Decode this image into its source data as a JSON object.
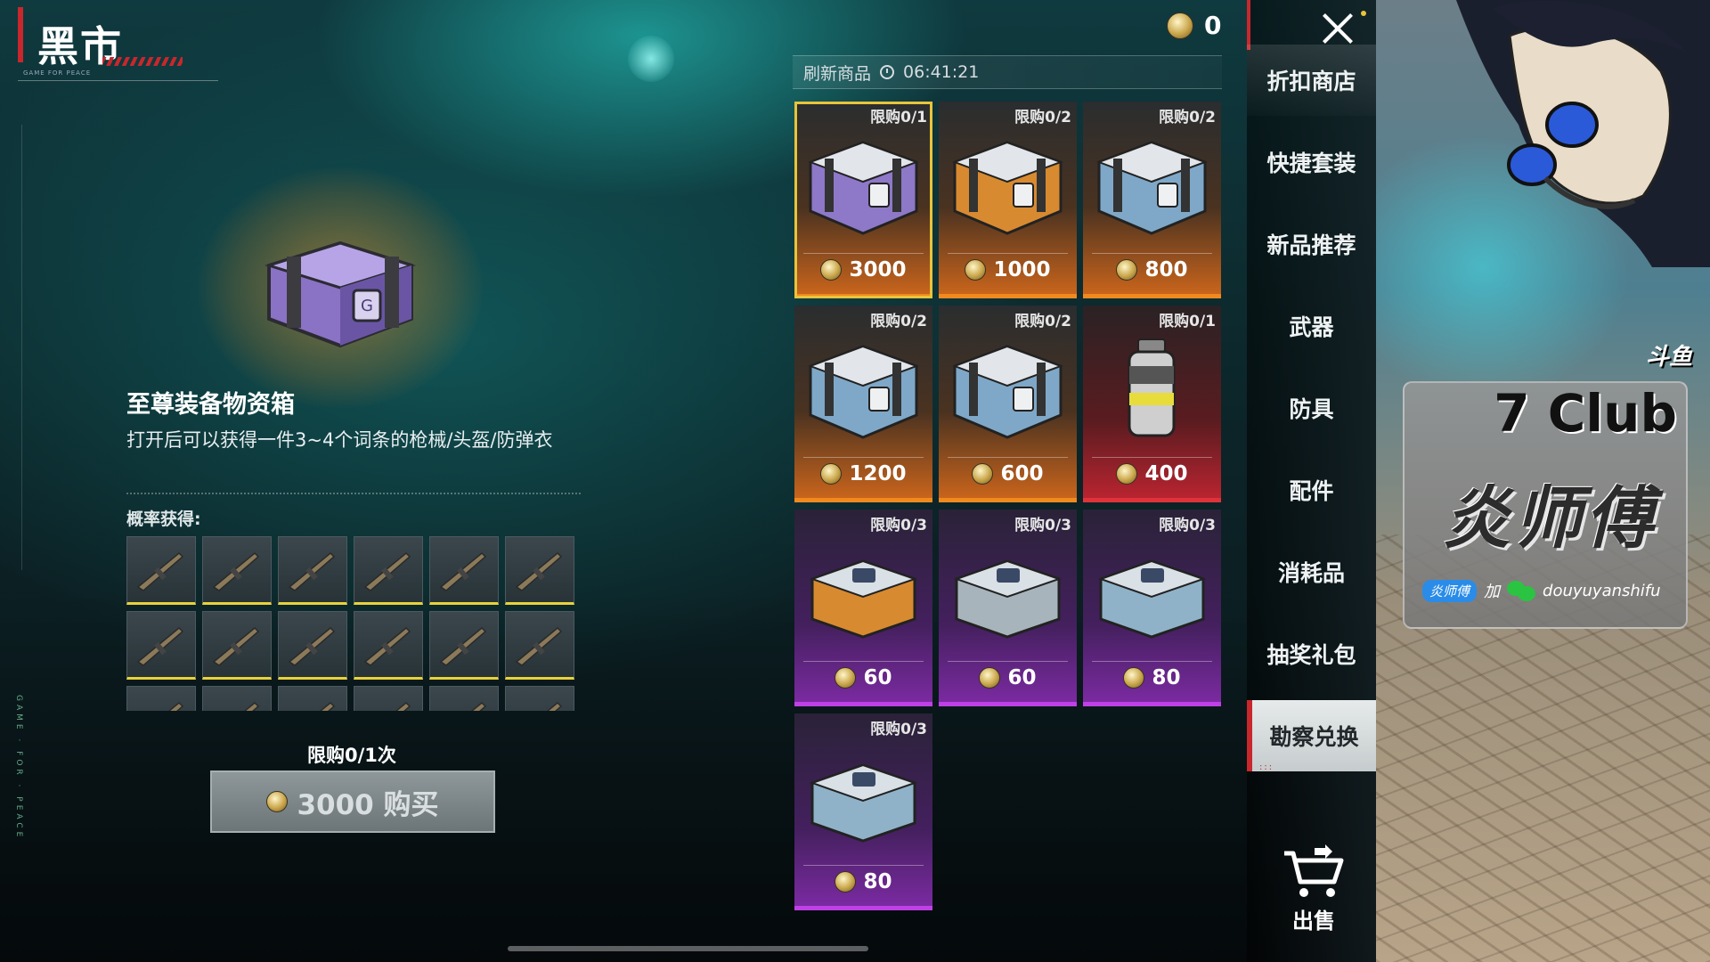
{
  "header": {
    "title": "黑市",
    "subtitle": "GAME FOR PEACE",
    "side_text": "GAME · FOR · PEACE"
  },
  "currency": {
    "amount": "0",
    "icon": "coin-icon"
  },
  "refresh": {
    "label": "刷新商品",
    "timer": "06:41:21"
  },
  "detail": {
    "name": "至尊装备物资箱",
    "description": "打开后可以获得一件3~4个词条的枪械/头盔/防弹衣",
    "prob_label": "概率获得:",
    "limit": "限购0/1次",
    "buy_label": "3000 购买",
    "gun_count": 18
  },
  "items": [
    {
      "limit": "限购0/1",
      "price": "3000",
      "theme": "orange",
      "icon": "purple-crate-icon",
      "color": "#8e78c8",
      "selected": true
    },
    {
      "limit": "限购0/2",
      "price": "1000",
      "theme": "orange",
      "icon": "orange-crate-icon",
      "color": "#d88a30"
    },
    {
      "limit": "限购0/2",
      "price": "800",
      "theme": "orange",
      "icon": "blue-crate-icon",
      "color": "#7fa8c8"
    },
    {
      "limit": "限购0/2",
      "price": "1200",
      "theme": "orange",
      "icon": "blue-crate-icon",
      "color": "#7fa8c8"
    },
    {
      "limit": "限购0/2",
      "price": "600",
      "theme": "orange",
      "icon": "blue-crate-icon",
      "color": "#7fa8c8"
    },
    {
      "limit": "限购0/1",
      "price": "400",
      "theme": "red",
      "icon": "canister-icon",
      "color": "#cfcfcf"
    },
    {
      "limit": "限购0/3",
      "price": "60",
      "theme": "purple",
      "icon": "orange-box-icon",
      "color": "#d88a30"
    },
    {
      "limit": "限购0/3",
      "price": "60",
      "theme": "purple",
      "icon": "gray-box-icon",
      "color": "#a8b4bc"
    },
    {
      "limit": "限购0/3",
      "price": "80",
      "theme": "purple",
      "icon": "blue-box-icon",
      "color": "#8fb2c8"
    },
    {
      "limit": "限购0/3",
      "price": "80",
      "theme": "purple",
      "icon": "blue-box-icon",
      "color": "#8fb2c8"
    }
  ],
  "nav": {
    "items": [
      "折扣商店",
      "快捷套装",
      "新品推荐",
      "武器",
      "防具",
      "配件",
      "消耗品",
      "抽奖礼包",
      "勘察兑换"
    ],
    "active": "勘察兑换",
    "sell": "出售"
  },
  "overlay": {
    "platform": "斗鱼",
    "club": "7 Club",
    "streamer": "炎师傅",
    "badge": "炎师傅",
    "plus": "加",
    "wechat": "douyuyanshifu"
  }
}
